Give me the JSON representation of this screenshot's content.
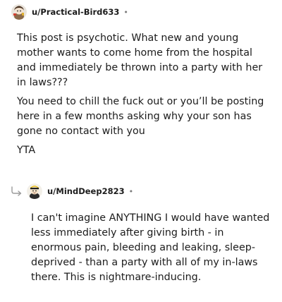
{
  "comments": [
    {
      "username": "u/Practical-Bird633",
      "separator": "•",
      "avatar_icon": "user-avatar-icon",
      "paragraphs": [
        "This post is psychotic. What new and young mother wants to come home from the hospital and immediately be thrown into a party with her in laws???",
        "You need to chill the fuck out or you’ll be posting here in a few months asking why your son has gone no contact with you",
        "YTA"
      ]
    },
    {
      "username": "u/MindDeep2823",
      "separator": "•",
      "avatar_icon": "user-avatar-icon",
      "reply_icon": "reply-arrow-icon",
      "paragraphs": [
        "I can't imagine ANYTHING I would have wanted less immediately after giving birth - in enormous pain, bleeding and leaking, sleep-deprived - than a party with all of my in-laws there. This is nightmare-inducing."
      ]
    }
  ],
  "colors": {
    "text": "#1c1c1c",
    "muted": "#7c7c7c",
    "background": "#ffffff"
  }
}
